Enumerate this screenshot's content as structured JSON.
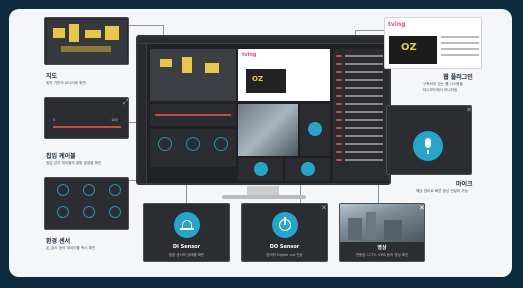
{
  "accent": "#27a4c9",
  "cards": {
    "map": {
      "title": "지도",
      "desc": "위치 기반의 모니터링 화면"
    },
    "web": {
      "title": "웹 플러그인",
      "desc1": "구축되어 있는 웹 시스템을",
      "desc2": "대시보드에서 모니터링"
    },
    "cable": {
      "title": "칩입 케이블",
      "desc": "침입 감지 케이블의 알람 발생을 확인",
      "left_value": "0",
      "right_value": "100"
    },
    "mic": {
      "title": "마이크",
      "desc": "해당 장비로 빠른 음성 전달이 가능"
    },
    "env": {
      "title": "환경 센서",
      "desc": "온_습도 등의 데이터를 즉시 확인"
    },
    "di": {
      "title": "DI Sensor",
      "desc": "접점 센서의 상태를 확인"
    },
    "do": {
      "title": "DO Sensor",
      "desc": "장비의 Digital out 전송"
    },
    "video": {
      "title": "영상",
      "desc": "연동된 CCTV, VMS 등의 영상 확인"
    }
  },
  "web_logo": "tving",
  "web_badge": "OZ",
  "icons": [
    "map-icon",
    "cable-slider",
    "mic-icon",
    "sensor-gauge-icon",
    "siren-icon",
    "power-icon",
    "video-feed",
    "close-icon"
  ]
}
